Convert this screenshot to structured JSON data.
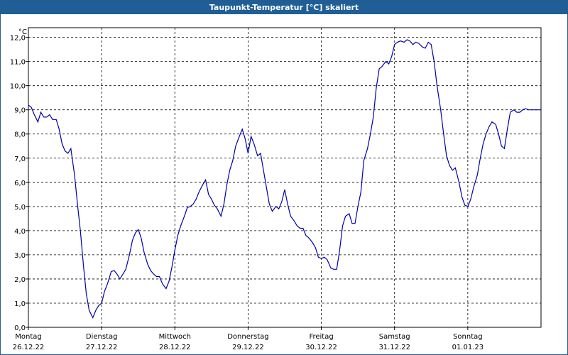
{
  "window": {
    "title": "Taupunkt-Temperatur [°C] skaliert"
  },
  "chart_data": {
    "type": "line",
    "title": "Taupunkt-Temperatur [°C] skaliert",
    "ylabel": "°C",
    "xlabel": "",
    "ylim": [
      0,
      12
    ],
    "xlim": [
      0,
      7
    ],
    "grid": true,
    "y_ticks": [
      "0,0",
      "1,0",
      "2,0",
      "3,0",
      "4,0",
      "5,0",
      "6,0",
      "7,0",
      "8,0",
      "9,0",
      "10,0",
      "11,0",
      "12,0"
    ],
    "x_ticks": [
      {
        "day": "Montag",
        "date": "26.12.22"
      },
      {
        "day": "Dienstag",
        "date": "27.12.22"
      },
      {
        "day": "Mittwoch",
        "date": "28.12.22"
      },
      {
        "day": "Donnerstag",
        "date": "29.12.22"
      },
      {
        "day": "Freitag",
        "date": "30.12.22"
      },
      {
        "day": "Samstag",
        "date": "31.12.22"
      },
      {
        "day": "Sonntag",
        "date": "01.01.23"
      }
    ],
    "line_color": "#0000aa",
    "series": [
      {
        "x": [
          0,
          0.04,
          0.08,
          0.13,
          0.17,
          0.21,
          0.25,
          0.29,
          0.33,
          0.38,
          0.42,
          0.46,
          0.5,
          0.54,
          0.58,
          0.63,
          0.67,
          0.71,
          0.75,
          0.79,
          0.83,
          0.88,
          0.92,
          0.96,
          1.0,
          1.04,
          1.08,
          1.13,
          1.17,
          1.21,
          1.25,
          1.29,
          1.33,
          1.38,
          1.42,
          1.46,
          1.5,
          1.54,
          1.58,
          1.63,
          1.67,
          1.71,
          1.75,
          1.79,
          1.83,
          1.88,
          1.92,
          1.96,
          2.0,
          2.04,
          2.08,
          2.13,
          2.17,
          2.21,
          2.25,
          2.29,
          2.33,
          2.38,
          2.42,
          2.46,
          2.5,
          2.54,
          2.58,
          2.63,
          2.67,
          2.71,
          2.75,
          2.79,
          2.83,
          2.88,
          2.92,
          2.96,
          3.0,
          3.04,
          3.08,
          3.13,
          3.17,
          3.21,
          3.25,
          3.29,
          3.33,
          3.38,
          3.42,
          3.46,
          3.5,
          3.54,
          3.58,
          3.63,
          3.67,
          3.71,
          3.75,
          3.79,
          3.83,
          3.88,
          3.92,
          3.96,
          4.0,
          4.04,
          4.08,
          4.13,
          4.17,
          4.21,
          4.25,
          4.29,
          4.33,
          4.38,
          4.42,
          4.46,
          4.5,
          4.54,
          4.58,
          4.63,
          4.67,
          4.71,
          4.75,
          4.79,
          4.83,
          4.88,
          4.92,
          4.96,
          5.0,
          5.04,
          5.08,
          5.13,
          5.17,
          5.21,
          5.25,
          5.29,
          5.33,
          5.38,
          5.42,
          5.46,
          5.5,
          5.54,
          5.58,
          5.63,
          5.67,
          5.71,
          5.75,
          5.79,
          5.83,
          5.88,
          5.92,
          5.96,
          6.0,
          6.04,
          6.08,
          6.13,
          6.17,
          6.21,
          6.25,
          6.29,
          6.33,
          6.38,
          6.42,
          6.46,
          6.5,
          6.54,
          6.58,
          6.63,
          6.67,
          6.71,
          6.75,
          6.79,
          6.83,
          6.88,
          6.92,
          6.96,
          7.0
        ],
        "values": [
          9.2,
          9.1,
          8.8,
          8.5,
          8.9,
          8.7,
          8.7,
          8.8,
          8.6,
          8.6,
          8.2,
          7.6,
          7.3,
          7.2,
          7.4,
          6.3,
          5.1,
          4.0,
          2.6,
          1.4,
          0.7,
          0.4,
          0.7,
          0.9,
          1.0,
          1.5,
          1.8,
          2.3,
          2.35,
          2.2,
          2.0,
          2.2,
          2.4,
          3.0,
          3.6,
          3.9,
          4.05,
          3.7,
          3.1,
          2.6,
          2.35,
          2.2,
          2.1,
          2.1,
          1.8,
          1.6,
          1.9,
          2.5,
          3.2,
          3.8,
          4.2,
          4.6,
          4.95,
          5.0,
          5.1,
          5.3,
          5.6,
          5.9,
          6.1,
          5.5,
          5.3,
          5.05,
          4.9,
          4.6,
          5.1,
          5.9,
          6.5,
          6.9,
          7.5,
          7.9,
          8.2,
          7.8,
          7.2,
          7.9,
          7.6,
          7.1,
          7.2,
          6.5,
          5.8,
          5.1,
          4.8,
          5.0,
          4.9,
          5.2,
          5.7,
          5.1,
          4.6,
          4.4,
          4.2,
          4.1,
          4.1,
          3.8,
          3.7,
          3.5,
          3.3,
          2.9,
          2.85,
          2.9,
          2.8,
          2.45,
          2.4,
          2.4,
          3.2,
          4.2,
          4.6,
          4.7,
          4.3,
          4.3,
          5.0,
          5.6,
          6.9,
          7.4,
          8.0,
          8.7,
          9.9,
          10.7,
          10.8,
          11.0,
          10.9,
          11.2,
          11.7,
          11.8,
          11.85,
          11.8,
          11.9,
          11.85,
          11.7,
          11.8,
          11.75,
          11.6,
          11.55,
          11.8,
          11.7,
          11.0,
          10.0,
          9.0,
          8.0,
          7.1,
          6.7,
          6.5,
          6.6,
          6.0,
          5.4,
          5.05,
          5.0,
          5.3,
          5.8,
          6.3,
          7.0,
          7.6,
          8.0,
          8.3,
          8.5,
          8.4,
          8.0,
          7.5,
          7.4,
          8.2,
          8.9,
          9.0,
          8.9,
          8.9,
          9.0,
          9.05,
          9.0,
          9.0,
          9.0,
          9.0,
          9.0
        ]
      }
    ]
  }
}
